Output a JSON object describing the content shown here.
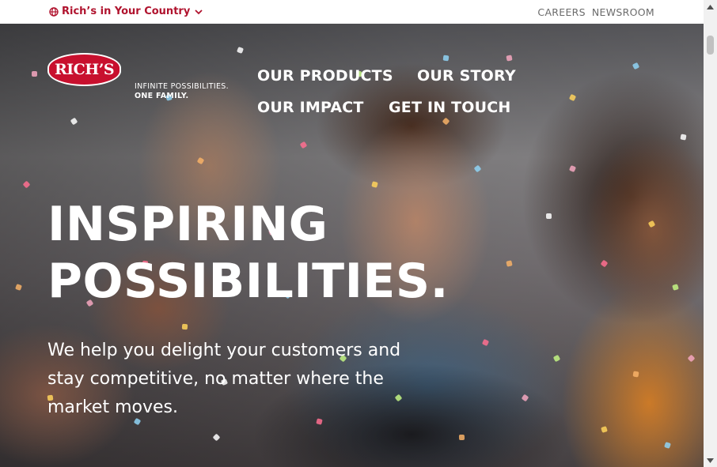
{
  "topbar": {
    "country_label": "Rich’s in Your Country",
    "links": [
      "CAREERS",
      "NEWSROOM"
    ],
    "accent_color": "#b0132e"
  },
  "brand": {
    "logo_text": "RICH’S",
    "tagline_line1": "INFINITE POSSIBILITIES.",
    "tagline_line2": "ONE FAMILY."
  },
  "nav": {
    "items": [
      "OUR PRODUCTS",
      "OUR STORY",
      "OUR IMPACT",
      "GET IN TOUCH"
    ]
  },
  "hero": {
    "headline_line1": "INSPIRING",
    "headline_line2": "POSSIBILITIES.",
    "subtext": "We help you delight your customers and stay competitive, no matter where the market moves."
  }
}
